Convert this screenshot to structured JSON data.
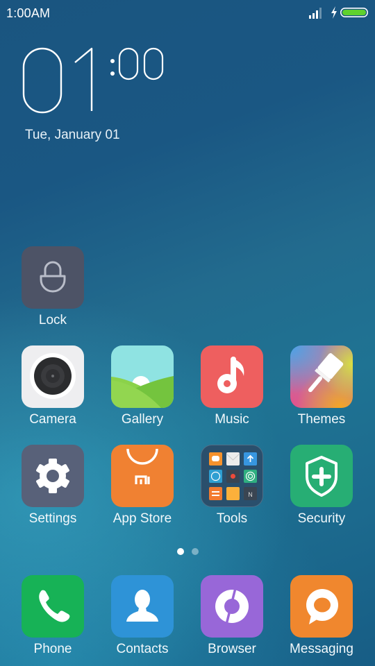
{
  "status_bar": {
    "time": "1:00AM",
    "signal_icon": "signal-bars-icon",
    "charging_icon": "charging-bolt-icon",
    "battery_icon": "battery-icon",
    "battery_color": "#5fd12e"
  },
  "clock_widget": {
    "hour": "01",
    "minute": ":00",
    "date": "Tue, January 01"
  },
  "apps": [
    {
      "label": "Lock",
      "icon": "lock-icon",
      "color": "#4d5366"
    },
    {
      "label": "Camera",
      "icon": "camera-icon",
      "color": "#eeeef0"
    },
    {
      "label": "Gallery",
      "icon": "gallery-icon",
      "color": "#8fe3e2"
    },
    {
      "label": "Music",
      "icon": "music-note-icon",
      "color": "#ee5f5f"
    },
    {
      "label": "Themes",
      "icon": "paintbrush-icon",
      "color": "#e27a9b"
    },
    {
      "label": "Settings",
      "icon": "gear-icon",
      "color": "#586179"
    },
    {
      "label": "App Store",
      "icon": "mi-bag-icon",
      "color": "#f08132"
    },
    {
      "label": "Tools",
      "icon": "folder-icon",
      "color": "#2a4f6c"
    },
    {
      "label": "Security",
      "icon": "shield-plus-icon",
      "color": "#27ae74"
    }
  ],
  "page_indicator": {
    "pages": 2,
    "current": 1
  },
  "dock": [
    {
      "label": "Phone",
      "icon": "phone-icon",
      "color": "#17b256"
    },
    {
      "label": "Contacts",
      "icon": "contact-person-icon",
      "color": "#2e93d7"
    },
    {
      "label": "Browser",
      "icon": "browser-icon",
      "color": "#9867d8"
    },
    {
      "label": "Messaging",
      "icon": "chat-bubble-icon",
      "color": "#f0872e"
    }
  ]
}
